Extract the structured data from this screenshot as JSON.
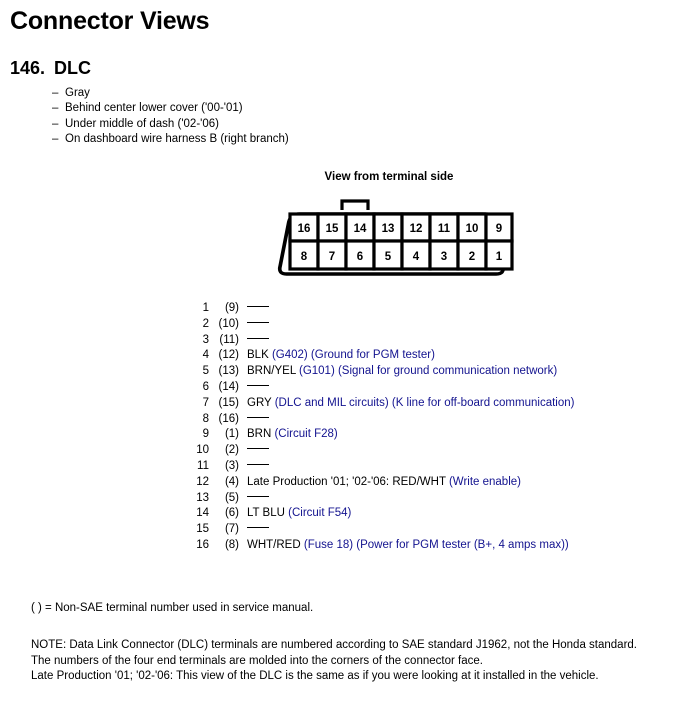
{
  "page_title": "Connector Views",
  "section": {
    "number": "146.",
    "name": "DLC"
  },
  "attributes": [
    "Gray",
    "Behind center lower cover  ('00-'01)",
    "Under middle of dash ('02-'06)",
    "On dashboard wire harness B (right branch)"
  ],
  "diagram": {
    "caption": "View from terminal side",
    "top_row_pins": [
      "16",
      "15",
      "14",
      "13",
      "12",
      "11",
      "10",
      "9"
    ],
    "bottom_row_pins": [
      "8",
      "7",
      "6",
      "5",
      "4",
      "3",
      "2",
      "1"
    ],
    "notch_label": "locking-tab"
  },
  "colors": {
    "circuit_blue": "#13138f",
    "text_black": "#000000",
    "background": "#ffffff"
  },
  "pins": [
    {
      "sae": "1",
      "service": "(9)",
      "wire": "",
      "circuit": "",
      "empty": true
    },
    {
      "sae": "2",
      "service": "(10)",
      "wire": "",
      "circuit": "",
      "empty": true
    },
    {
      "sae": "3",
      "service": "(11)",
      "wire": "",
      "circuit": "",
      "empty": true
    },
    {
      "sae": "4",
      "service": "(12)",
      "wire": "BLK",
      "circuit": "(G402) (Ground for PGM tester)",
      "empty": false
    },
    {
      "sae": "5",
      "service": "(13)",
      "wire": "BRN/YEL",
      "circuit": "(G101) (Signal for ground communication network)",
      "empty": false
    },
    {
      "sae": "6",
      "service": "(14)",
      "wire": "",
      "circuit": "",
      "empty": true
    },
    {
      "sae": "7",
      "service": "(15)",
      "wire": "GRY",
      "circuit": "(DLC and MIL circuits) (K line for off-board communication)",
      "empty": false
    },
    {
      "sae": "8",
      "service": "(16)",
      "wire": "",
      "circuit": "",
      "empty": true
    },
    {
      "sae": "9",
      "service": "(1)",
      "wire": "BRN",
      "circuit": "(Circuit F28)",
      "empty": false
    },
    {
      "sae": "10",
      "service": "(2)",
      "wire": "",
      "circuit": "",
      "empty": true
    },
    {
      "sae": "11",
      "service": "(3)",
      "wire": "",
      "circuit": "",
      "empty": true
    },
    {
      "sae": "12",
      "service": "(4)",
      "wire": "Late Production '01; '02-'06: RED/WHT",
      "circuit": "(Write enable)",
      "empty": false
    },
    {
      "sae": "13",
      "service": "(5)",
      "wire": "",
      "circuit": "",
      "empty": true
    },
    {
      "sae": "14",
      "service": "(6)",
      "wire": "LT BLU",
      "circuit": "(Circuit F54)",
      "empty": false
    },
    {
      "sae": "15",
      "service": "(7)",
      "wire": "",
      "circuit": "",
      "empty": true
    },
    {
      "sae": "16",
      "service": "(8)",
      "wire": "WHT/RED",
      "circuit": "(Fuse 18) (Power for PGM tester (B+, 4 amps max))",
      "empty": false
    }
  ],
  "footnote": "( ) = Non-SAE terminal number used in service manual.",
  "notes": [
    "NOTE: Data Link Connector (DLC) terminals are numbered according to SAE standard J1962, not the Honda standard.",
    "The numbers of the four end terminals are molded into the corners of the connector face.",
    "Late Production '01; '02-'06: This view of the DLC is the same as if you were looking at it installed in the vehicle."
  ]
}
